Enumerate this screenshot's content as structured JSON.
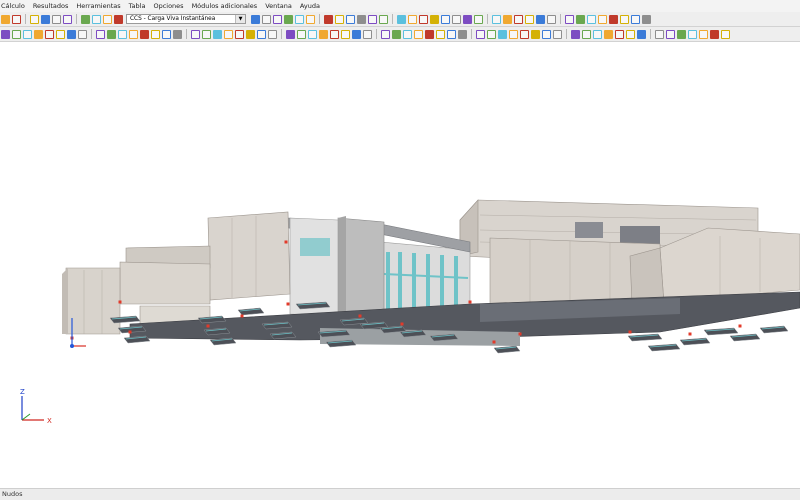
{
  "menu": {
    "items": [
      "Cálculo",
      "Resultados",
      "Herramientas",
      "Tabla",
      "Opciones",
      "Módulos adicionales",
      "Ventana",
      "Ayuda"
    ]
  },
  "toolbar": {
    "load_case_select": "CCS - Carga Viva Instantánea"
  },
  "axes": {
    "z": "Z",
    "x": "X"
  },
  "status": {
    "mode": "Nudos"
  },
  "colors": {
    "accent": "#f0a830",
    "panel": "#d9d4ce",
    "slab_dark": "#4a4d55",
    "glass": "#6fc3c8",
    "support": "#e23a2a"
  }
}
